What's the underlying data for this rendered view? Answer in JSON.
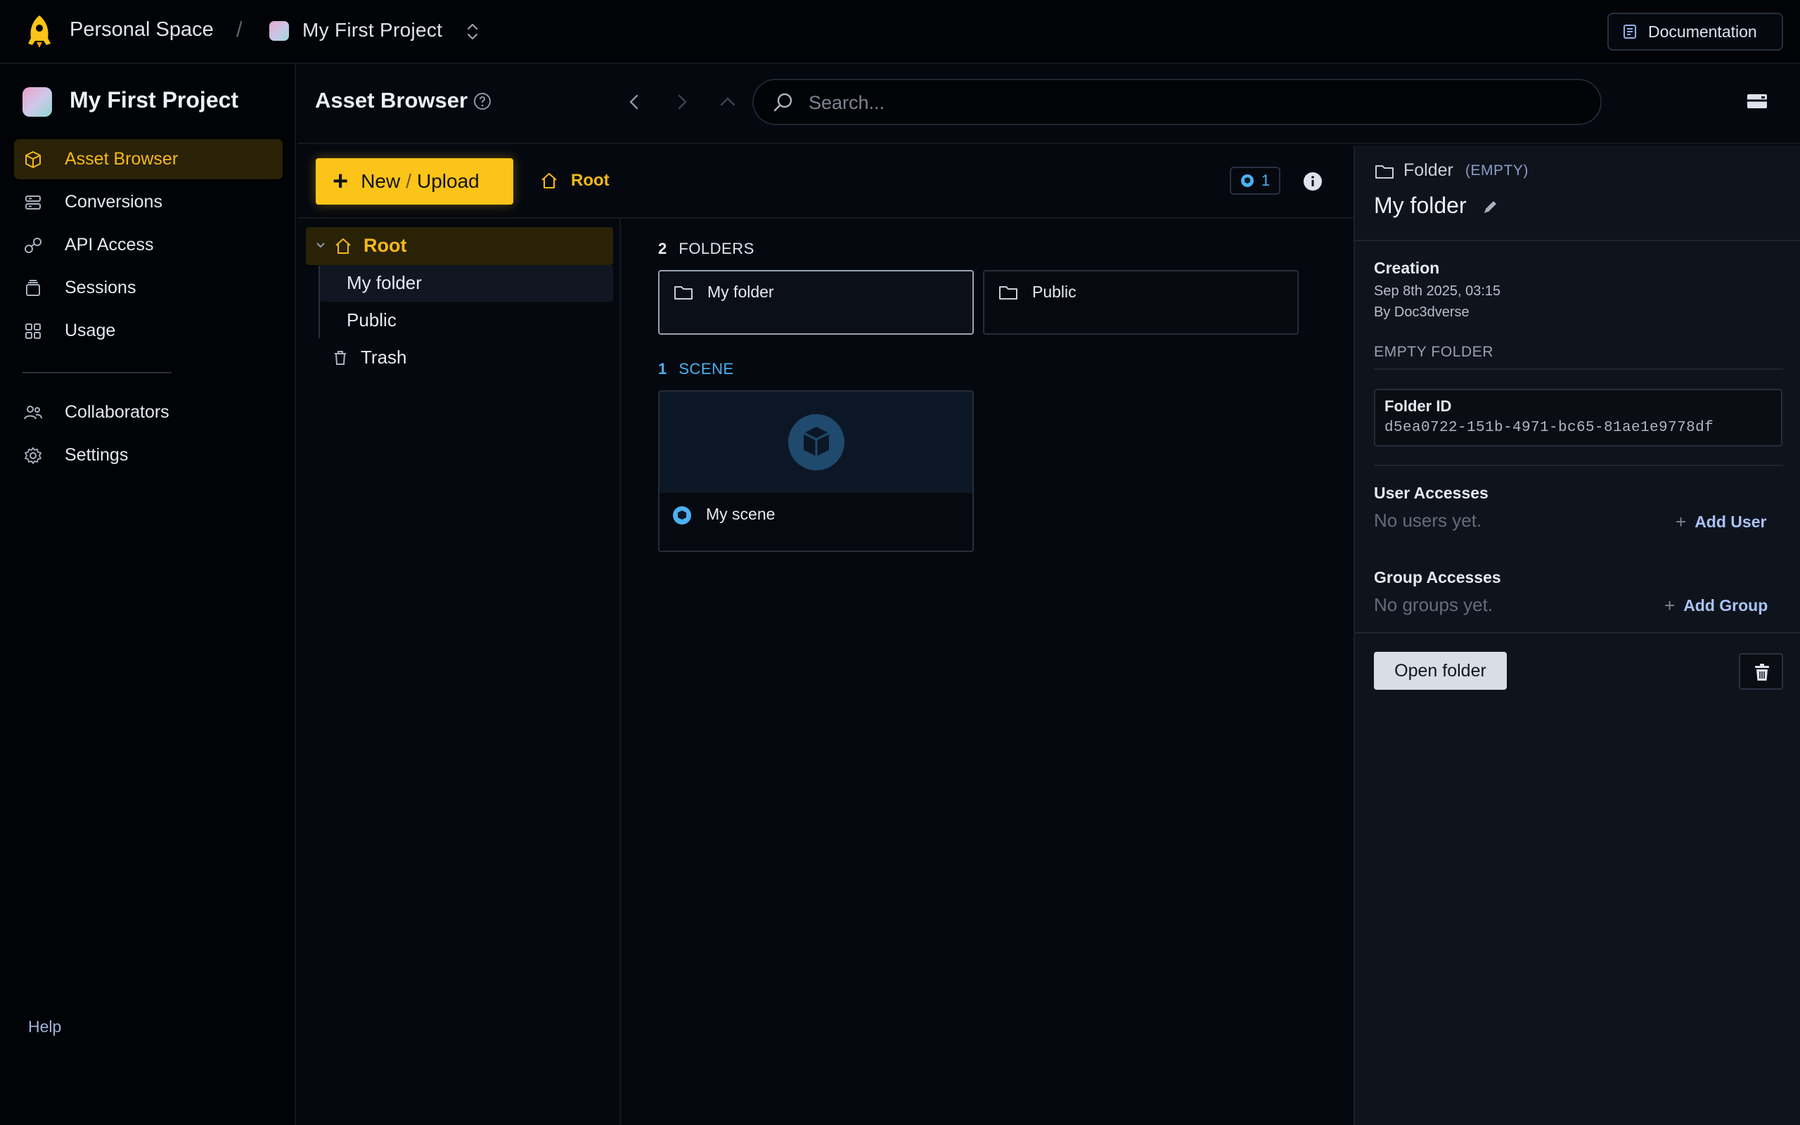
{
  "topbar": {
    "space_name": "Personal Space",
    "separator": "/",
    "project_name": "My First Project",
    "documentation_label": "Documentation"
  },
  "sidebar": {
    "project_name": "My First Project",
    "items": [
      {
        "label": "Asset Browser",
        "icon": "cube-icon",
        "active": true
      },
      {
        "label": "Conversions",
        "icon": "conversions-icon",
        "active": false
      },
      {
        "label": "API Access",
        "icon": "key-icon",
        "active": false
      },
      {
        "label": "Sessions",
        "icon": "sessions-icon",
        "active": false
      },
      {
        "label": "Usage",
        "icon": "usage-grid-icon",
        "active": false
      },
      {
        "label": "Collaborators",
        "icon": "users-icon",
        "active": false
      },
      {
        "label": "Settings",
        "icon": "gear-icon",
        "active": false
      }
    ],
    "help_label": "Help"
  },
  "header": {
    "title": "Asset Browser",
    "search_placeholder": "Search..."
  },
  "toolbar": {
    "new_label": "New",
    "slash": "/",
    "upload_label": "Upload",
    "breadcrumb_root": "Root",
    "scene_count": "1"
  },
  "tree": {
    "root_label": "Root",
    "children": [
      "My folder",
      "Public"
    ],
    "trash_label": "Trash"
  },
  "content": {
    "folders_count": "2",
    "folders_label": "FOLDERS",
    "folders": [
      "My folder",
      "Public"
    ],
    "scenes_count": "1",
    "scenes_label": "SCENE",
    "scenes": [
      "My scene"
    ]
  },
  "details": {
    "kind": "Folder",
    "empty_tag": "(EMPTY)",
    "name": "My folder",
    "creation_label": "Creation",
    "creation_date": "Sep 8th 2025, 03:15",
    "creation_by": "By Doc3dverse",
    "empty_folder_caption": "EMPTY FOLDER",
    "folder_id_label": "Folder ID",
    "folder_id": "d5ea0722-151b-4971-bc65-81ae1e9778df",
    "user_accesses_label": "User Accesses",
    "no_users": "No users yet.",
    "add_user_label": "Add User",
    "group_accesses_label": "Group Accesses",
    "no_groups": "No groups yet.",
    "add_group_label": "Add Group",
    "open_folder_label": "Open folder"
  },
  "colors": {
    "accent": "#fcc419",
    "accent_text": "#f5b91a",
    "scene_blue": "#4ab1f0",
    "background": "#05080f"
  }
}
